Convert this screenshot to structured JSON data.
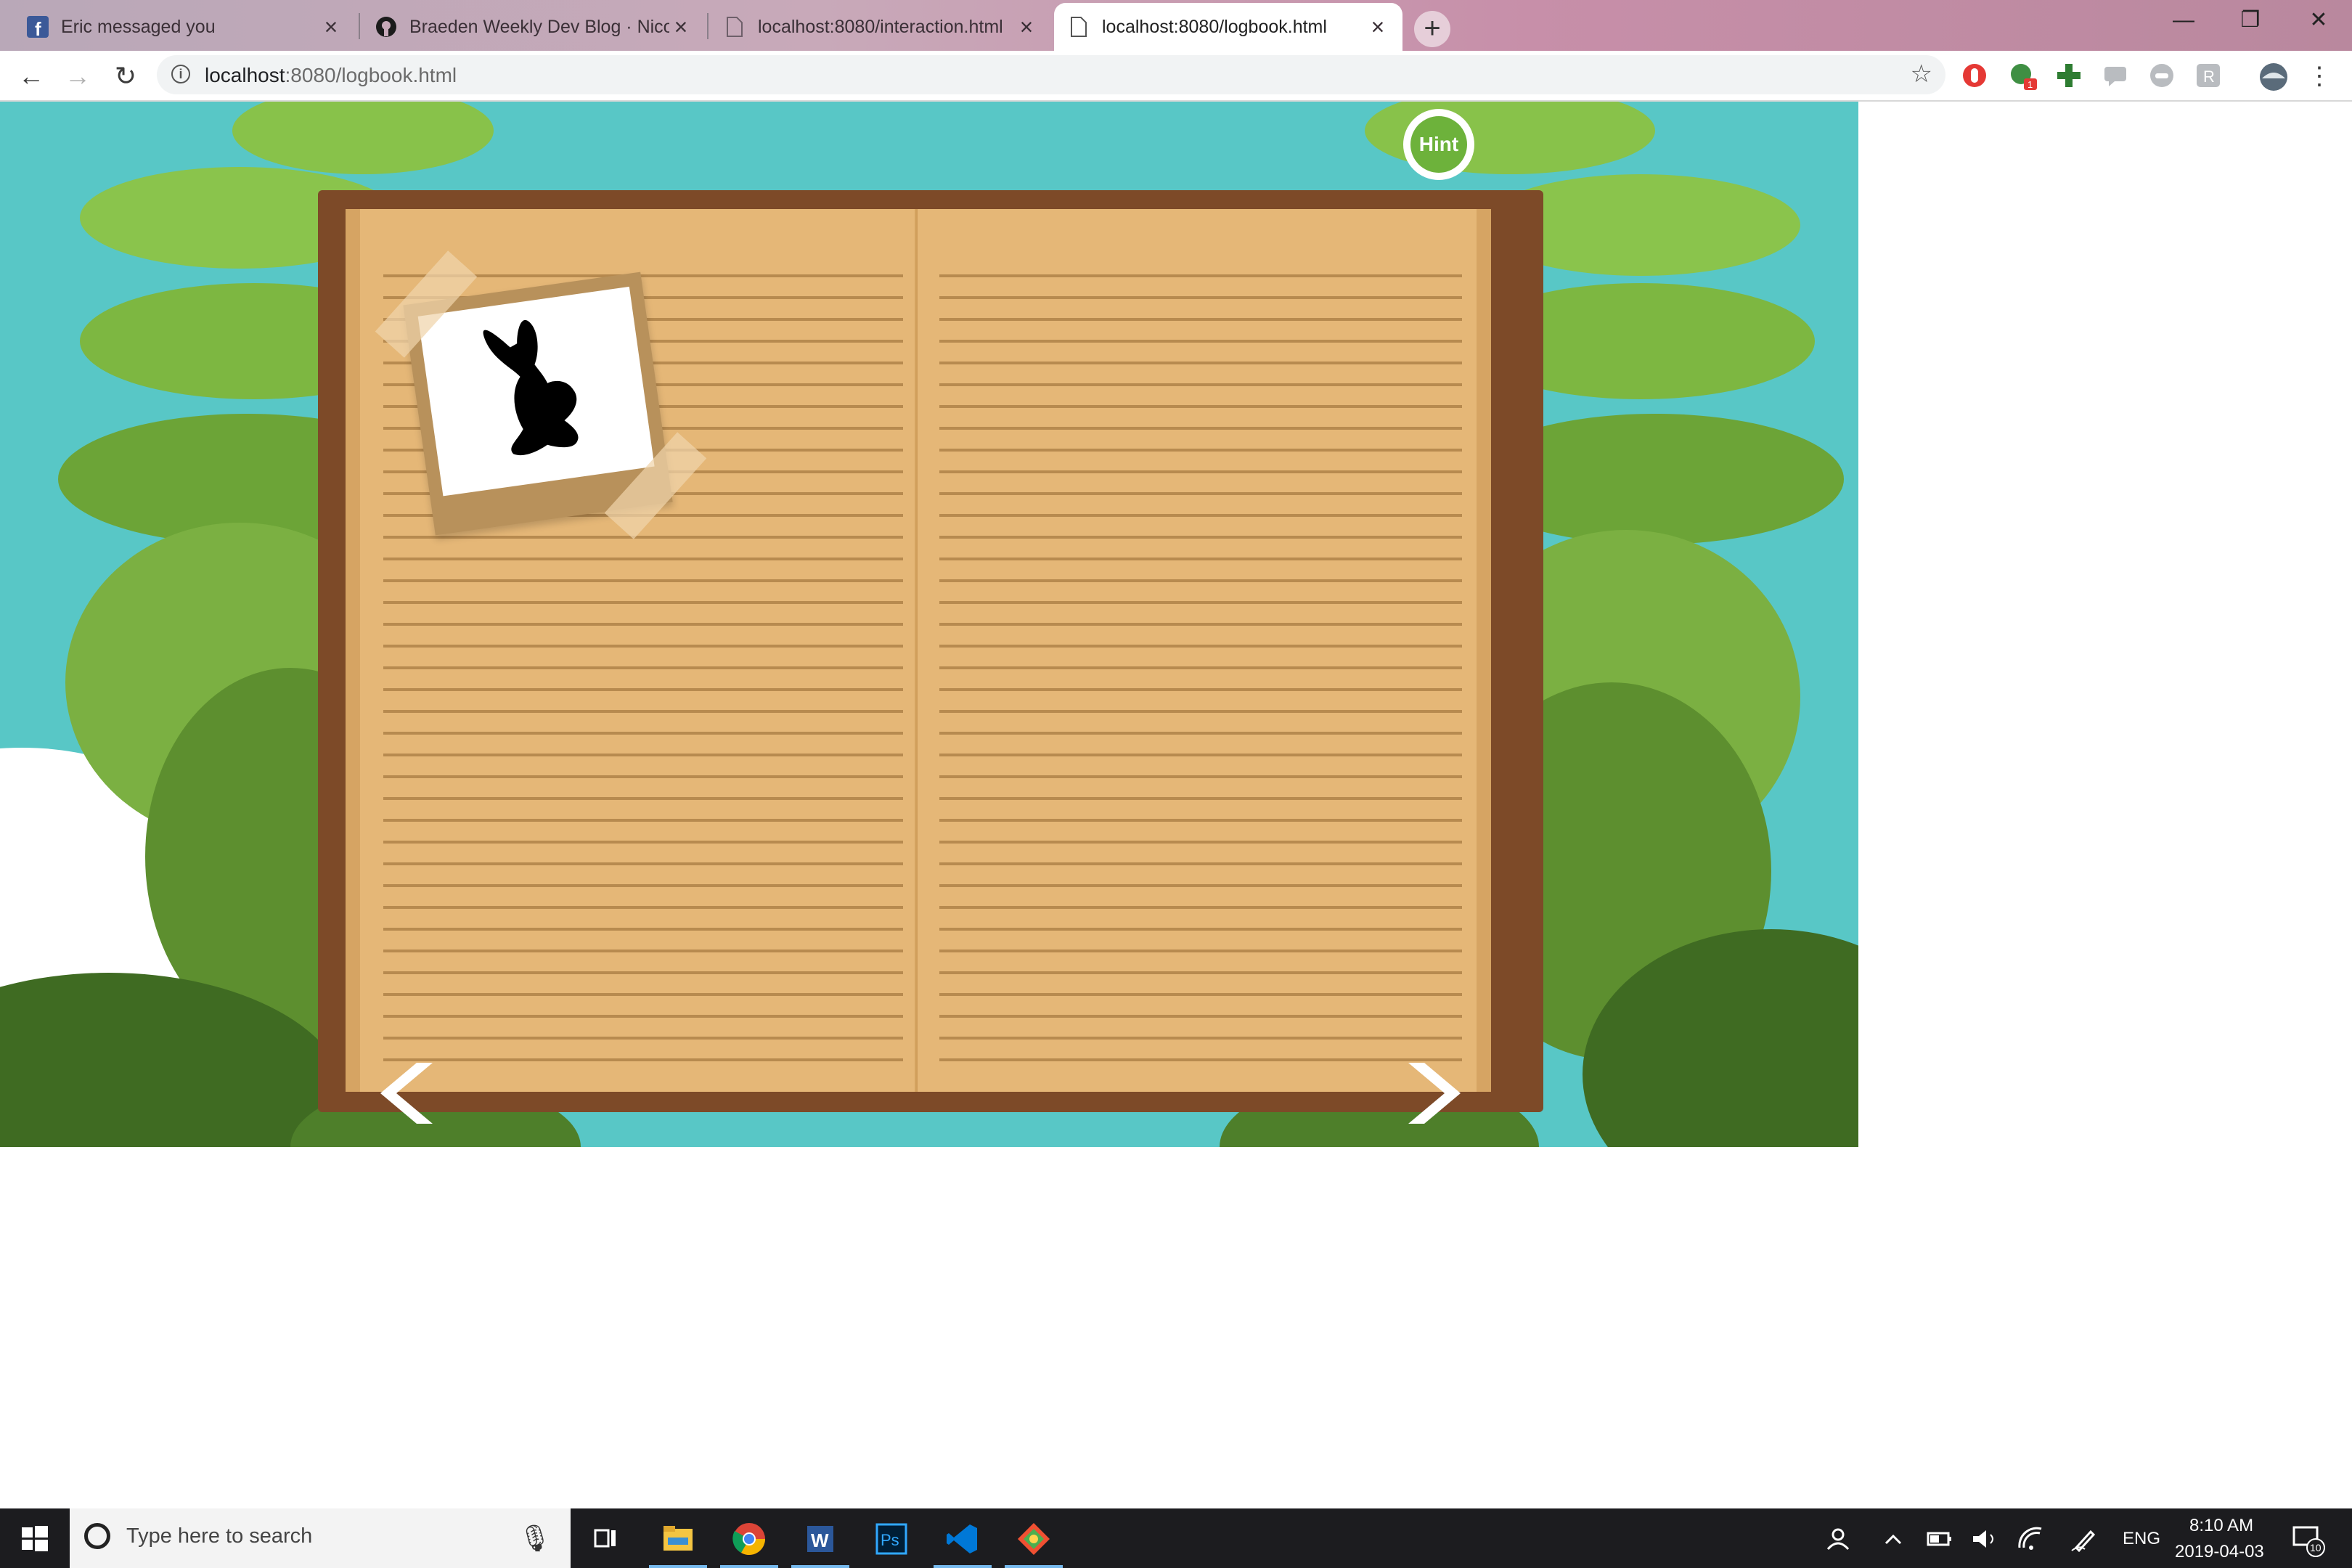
{
  "browser": {
    "tabs": [
      {
        "title": "Eric messaged you",
        "active": false
      },
      {
        "title": "Braeden Weekly Dev Blog · Nicol",
        "active": false
      },
      {
        "title": "localhost:8080/interaction.html",
        "active": false
      },
      {
        "title": "localhost:8080/logbook.html",
        "active": true
      }
    ],
    "address": {
      "host": "localhost",
      "rest": ":8080/logbook.html"
    },
    "extension_badge": "1"
  },
  "game": {
    "hint_label": "Hint",
    "photo_subject": "rabbit-silhouette-icon"
  },
  "taskbar": {
    "search_placeholder": "Type here to search",
    "language": "ENG",
    "time": "8:10 AM",
    "date": "2019-04-03",
    "notifications_count": "10"
  },
  "colors": {
    "sky": "#58c7c6",
    "book_cover": "#7d4a28",
    "page": "#e5b777",
    "hint_green": "#6db23b"
  }
}
